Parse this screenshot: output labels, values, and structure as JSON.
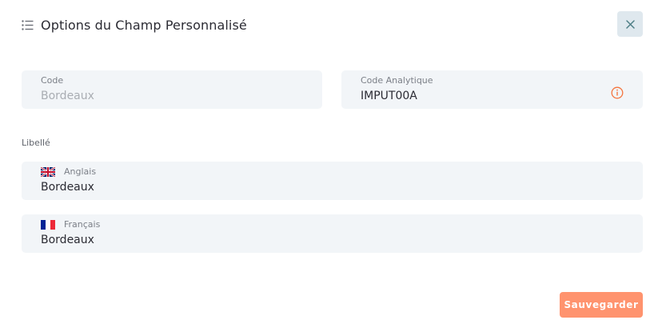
{
  "header": {
    "title": "Options du Champ Personnalisé"
  },
  "fields": {
    "code": {
      "label": "Code",
      "value": "Bordeaux"
    },
    "analytic": {
      "label": "Code Analytique",
      "value": "IMPUT00A"
    }
  },
  "libelle": {
    "section_label": "Libellé",
    "english": {
      "language": "Anglais",
      "value": "Bordeaux"
    },
    "french": {
      "language": "Français",
      "value": "Bordeaux"
    }
  },
  "actions": {
    "save_label": "Sauvegarder"
  },
  "colors": {
    "accent": "#ff936e",
    "info": "#f4753f",
    "close_bg": "#dfe8ee",
    "field_bg": "#f2f5f8"
  }
}
